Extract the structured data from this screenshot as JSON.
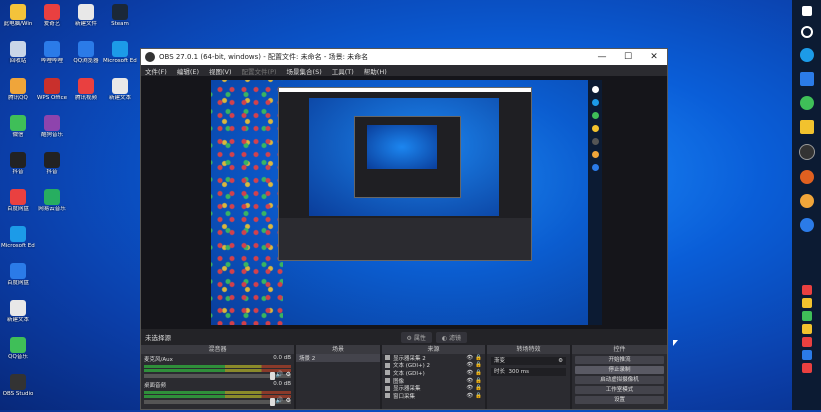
{
  "desktop": {
    "icons": [
      {
        "label": "此电脑/Win",
        "color": "#f3c33b"
      },
      {
        "label": "回收站",
        "color": "#c9d6e8"
      },
      {
        "label": "腾讯QQ",
        "color": "#f0a53a"
      },
      {
        "label": "微信",
        "color": "#3fbf58"
      },
      {
        "label": "抖音",
        "color": "#222222"
      },
      {
        "label": "百度网盘",
        "color": "#e94040"
      },
      {
        "label": "Microsoft Edge",
        "color": "#1c9be8"
      },
      {
        "label": "百度网盘",
        "color": "#2b7be8"
      },
      {
        "label": "新建文本",
        "color": "#e8e8e8"
      },
      {
        "label": "QQ音乐",
        "color": "#3fbf58"
      },
      {
        "label": "OBS Studio",
        "color": "#333333"
      },
      {
        "label": "爱奇艺",
        "color": "#e94040"
      },
      {
        "label": "哔哩哔哩",
        "color": "#2b7be8"
      },
      {
        "label": "WPS Office",
        "color": "#c9302c"
      },
      {
        "label": "酷狗音乐",
        "color": "#8e44ad"
      },
      {
        "label": "抖音",
        "color": "#222222"
      },
      {
        "label": "网易云音乐",
        "color": "#27ae60"
      },
      {
        "label": "新建文件",
        "color": "#e8e8e8"
      },
      {
        "label": "QQ浏览器",
        "color": "#2b7be8"
      },
      {
        "label": "腾讯视频",
        "color": "#e94040"
      },
      {
        "label": "Steam",
        "color": "#1b2838"
      },
      {
        "label": "Microsoft Edge",
        "color": "#1c9be8"
      },
      {
        "label": "新建文本",
        "color": "#e8e8e8"
      }
    ]
  },
  "window": {
    "title": "OBS 27.0.1 (64-bit, windows) - 配置文件: 未命名 - 场景: 未命名",
    "minimize": "—",
    "maximize": "☐",
    "close": "✕"
  },
  "menu": [
    "文件(F)",
    "编辑(E)",
    "视图(V)",
    "配置文件(P)",
    "场景集合(S)",
    "工具(T)",
    "帮助(H)"
  ],
  "menu_disabled_index": 3,
  "status": {
    "no_source": "未选择源",
    "properties": "属性",
    "filters": "滤镜"
  },
  "docks": {
    "mixer": {
      "header": "混音器",
      "channels": [
        {
          "name": "麦克风/Aux",
          "db": "0.0 dB"
        },
        {
          "name": "桌面音频",
          "db": "0.0 dB"
        }
      ]
    },
    "scenes": {
      "header": "场景",
      "items": [
        "场景 2"
      ]
    },
    "sources": {
      "header": "来源",
      "items": [
        "显示器采集 2",
        "文本 (GDI+) 2",
        "文本 (GDI+)",
        "图像",
        "显示器采集",
        "窗口采集"
      ]
    },
    "transitions": {
      "header": "转场特效",
      "type": "渐变",
      "duration_label": "时长",
      "duration": "300 ms"
    },
    "controls": {
      "header": "控件",
      "buttons": [
        "开始推流",
        "停止录制",
        "启动虚拟摄像机",
        "工作室模式",
        "设置"
      ]
    }
  },
  "colors": {
    "obs_bg": "#1f1f23",
    "panel": "#2b2b30",
    "desktop_blue": "#0b5dd0"
  }
}
